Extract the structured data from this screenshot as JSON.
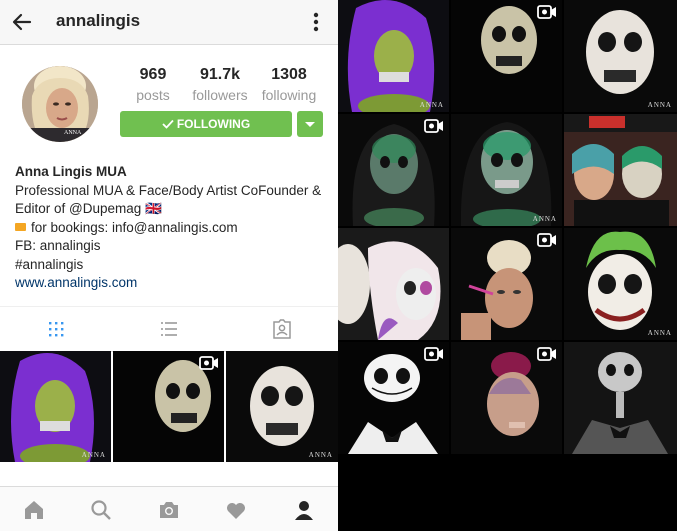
{
  "header": {
    "username": "annalingis"
  },
  "stats": [
    {
      "value": "969",
      "label": "posts"
    },
    {
      "value": "91.7k",
      "label": "followers"
    },
    {
      "value": "1308",
      "label": "following"
    }
  ],
  "follow_button": {
    "label": "FOLLOWING"
  },
  "bio": {
    "name": "Anna Lingis MUA",
    "line1": "Professional MUA & Face/Body Artist CoFounder &",
    "line2": "Editor of @Dupemag 🇬🇧",
    "line3": "for bookings: info@annalingis.com",
    "line4": "FB: annalingis",
    "line5": "#annalingis",
    "website": "www.annalingis.com"
  },
  "watermark": "ANNA",
  "colors": {
    "follow_green": "#70c050",
    "link_blue": "#003569"
  },
  "icons": [
    "back-arrow-icon",
    "more-options-icon",
    "checkmark-icon",
    "chevron-down-icon",
    "grid-view-icon",
    "list-view-icon",
    "tagged-photos-icon",
    "home-icon",
    "search-icon",
    "camera-icon",
    "heart-icon",
    "profile-icon",
    "video-icon"
  ]
}
